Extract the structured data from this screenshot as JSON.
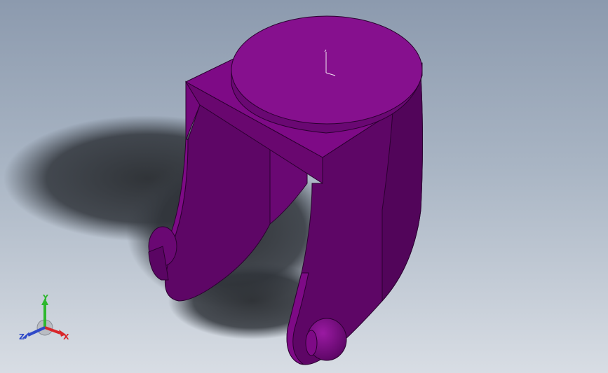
{
  "viewport": {
    "model_color": "#7e0a86",
    "background_top": "#8c9aae",
    "background_bottom": "#d8dde4"
  },
  "triad": {
    "x_label": "X",
    "y_label": "Y",
    "z_label": "Z",
    "x_color": "#d8262a",
    "y_color": "#2eb82e",
    "z_color": "#2f49c8"
  }
}
